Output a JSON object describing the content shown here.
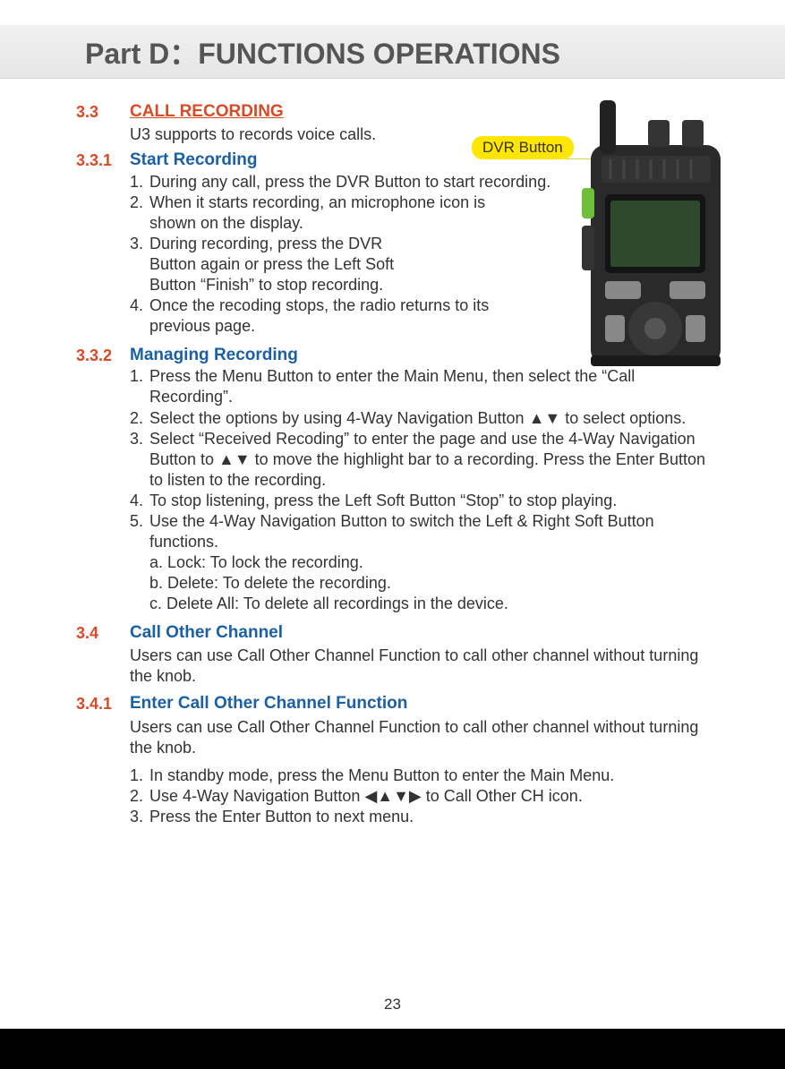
{
  "header": {
    "title": "Part D：FUNCTIONS OPERATIONS"
  },
  "page_number": "23",
  "s33": {
    "num": "3.3",
    "title": "CALL RECORDING",
    "intro": "U3 supports to records voice calls."
  },
  "s331": {
    "num": "3.3.1",
    "title": "Start Recording",
    "items": {
      "i1": {
        "n": "1.",
        "t": "During any call, press the DVR Button to start recording."
      },
      "i2": {
        "n": "2.",
        "t": "When it starts recording, an microphone icon is shown on the display."
      },
      "i3": {
        "n": "3.",
        "t": "During recording, press the DVR Button again or press the Left Soft Button “Finish” to stop recording."
      },
      "i4": {
        "n": "4.",
        "t": "Once the recoding stops, the radio returns to its previous page."
      }
    },
    "callout": "DVR Button"
  },
  "s332": {
    "num": "3.3.2",
    "title": "Managing Recording",
    "items": {
      "i1": {
        "n": "1.",
        "t": "Press the Menu Button to enter the Main Menu, then select the “Call Recording”."
      },
      "i2": {
        "n": "2.",
        "t": "Select the options by using 4-Way Navigation Button ▲▼ to select options."
      },
      "i3": {
        "n": "3.",
        "t": "Select “Received Recoding” to enter the page and use the 4-Way Navigation Button to ▲▼ to move the highlight bar to a recording. Press the Enter Button to listen to the recording."
      },
      "i4": {
        "n": "4.",
        "t": "To stop listening, press the Left Soft Button “Stop” to stop playing."
      },
      "i5": {
        "n": "5.",
        "t": "Use the 4-Way Navigation Button to switch the Left & Right Soft Button functions."
      },
      "sa": "a. Lock: To lock the recording.",
      "sb": "b. Delete: To delete the recording.",
      "sc": "c. Delete All: To delete all recordings in the device."
    }
  },
  "s34": {
    "num": "3.4",
    "title": "Call Other Channel",
    "intro": "Users can use Call Other Channel Function to call other channel without turning the knob."
  },
  "s341": {
    "num": "3.4.1",
    "title": "Enter Call Other Channel Function",
    "intro": "Users can use Call Other Channel Function to call other channel without turning the knob.",
    "items": {
      "i1": {
        "n": "1.",
        "t": "In standby mode, press the Menu Button to enter the Main Menu."
      },
      "i2": {
        "n": "2.",
        "t": "Use 4-Way Navigation Button ◀▲▼▶ to Call Other CH icon."
      },
      "i3": {
        "n": "3.",
        "t": "Press the Enter Button to next menu."
      }
    }
  }
}
